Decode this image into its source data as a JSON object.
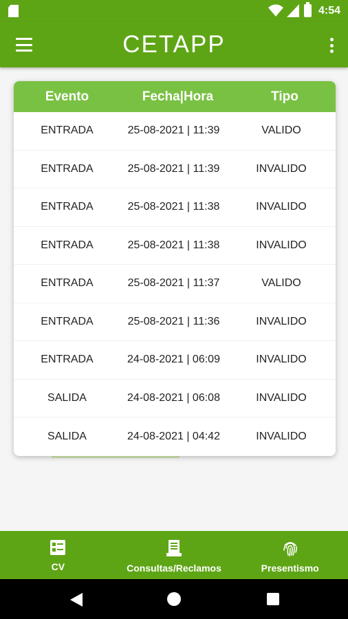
{
  "status_bar": {
    "time": "4:54"
  },
  "app_bar": {
    "title": "CETAPP"
  },
  "table": {
    "headers": [
      "Evento",
      "Fecha|Hora",
      "Tipo"
    ],
    "rows": [
      [
        "ENTRADA",
        "25-08-2021 | 11:39",
        "VALIDO"
      ],
      [
        "ENTRADA",
        "25-08-2021 | 11:39",
        "INVALIDO"
      ],
      [
        "ENTRADA",
        "25-08-2021 | 11:38",
        "INVALIDO"
      ],
      [
        "ENTRADA",
        "25-08-2021 | 11:38",
        "INVALIDO"
      ],
      [
        "ENTRADA",
        "25-08-2021 | 11:37",
        "VALIDO"
      ],
      [
        "ENTRADA",
        "25-08-2021 | 11:36",
        "INVALIDO"
      ],
      [
        "ENTRADA",
        "24-08-2021 | 06:09",
        "INVALIDO"
      ],
      [
        "SALIDA",
        "24-08-2021 | 06:08",
        "INVALIDO"
      ],
      [
        "SALIDA",
        "24-08-2021 | 04:42",
        "INVALIDO"
      ]
    ]
  },
  "bottom_nav": {
    "items": [
      {
        "label": "CV",
        "icon": "id-card-icon"
      },
      {
        "label": "Consultas/Reclamos",
        "icon": "document-icon"
      },
      {
        "label": "Presentismo",
        "icon": "fingerprint-icon"
      }
    ]
  },
  "colors": {
    "primary": "#5ea516",
    "header": "#79c143"
  }
}
